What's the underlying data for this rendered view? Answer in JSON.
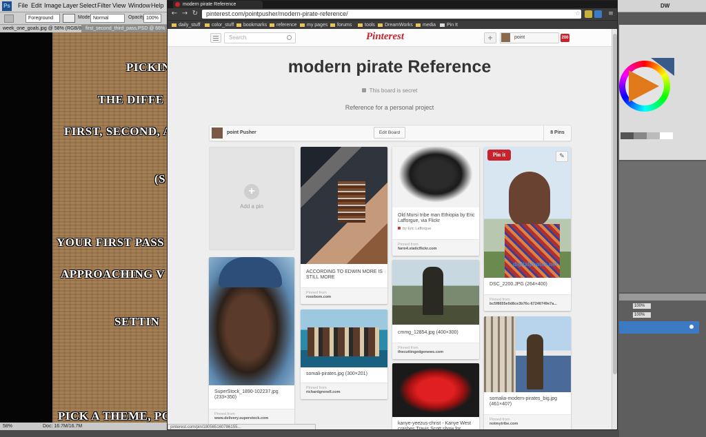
{
  "photoshop": {
    "logo": "Ps",
    "menus": [
      "File",
      "Edit",
      "Image",
      "Layer",
      "Select",
      "Filter",
      "View",
      "Window",
      "Help"
    ],
    "options": {
      "tool_preset": "Foreground",
      "mode_label": "Mode:",
      "mode_value": "Normal",
      "opacity_label": "Opacity:",
      "opacity_value": "100%"
    },
    "doc_tabs": [
      "week_one_goals.jpg @ 58% (RGB/8)",
      "first_second_third_pass.PSD @ 66% (Layer 1, RGB/8)"
    ],
    "canvas_lines": [
      "PICKIN",
      "THE DIFFE",
      "FIRST, SECOND, A",
      "(S",
      "YOUR FIRST PASS",
      "APPROACHING V",
      "SETTIN",
      "PICK A THEME, PO"
    ],
    "status_zoom": "58%",
    "status_doc": "Doc: 16.7M/16.7M",
    "workspace": "DW",
    "panel_fields": [
      "100%",
      "100%"
    ]
  },
  "browser": {
    "tab_title": "modern pirate Reference",
    "url": "pinterest.com/pointpusher/modern-pirate-reference/",
    "bookmarks": [
      "daily_stuff",
      "color_stuff",
      "bookmarks",
      "reference",
      "my pages",
      "forums",
      "tools",
      "DreamWorks",
      "media",
      "Pin It"
    ],
    "status_url": "pinterest.com/pin/180565160786155...",
    "colors": {
      "pinterest_red": "#c8232c",
      "page_bg": "#eeeeee"
    }
  },
  "pinterest": {
    "search_placeholder": "Search",
    "logo": "Pinterest",
    "user": "point",
    "notifications": "200",
    "board": {
      "title": "modern pirate Reference",
      "secret": "This board is secret",
      "description": "Reference for a personal project",
      "owner": "point Pusher",
      "edit_label": "Edit Board",
      "pins_count": "8 Pins"
    },
    "add_pin_label": "Add a pin",
    "pin_it": "Pin it",
    "pins": [
      {
        "caption": "Old Mursi tribe man Ethiopia by Eric Lafforgue, via Flickr",
        "via": "by Eric Lafforgue",
        "src_label": "Pinned from",
        "src": "farm4.staticflickr.com"
      },
      {
        "caption": "DSC_2200.JPG (264×400)",
        "src_label": "Pinned from",
        "src": "bc5f8655e0d8ce3b76c-67246749e7a..."
      },
      {
        "caption": "ACCORDING TO EDWIN MORE IS STILL MORE",
        "src_label": "Pinned from",
        "src": "rosebom.com"
      },
      {
        "caption": "cmmg_12854.jpg (400×300)",
        "src_label": "Pinned from",
        "src": "thecuttingedgenews.com"
      },
      {
        "caption": "SuperStock_1890-102237.jpg (233×350)",
        "src_label": "Pinned from",
        "src": "www.delivery.superstock.com"
      },
      {
        "caption": "somali-pirates.jpg (300×201)",
        "src_label": "Pinned from",
        "src": "richardgrenell.com"
      },
      {
        "caption": "somalia-modern-pirates_big.jpg (461×407)",
        "src_label": "Pinned from",
        "src": "notmytribe.com"
      },
      {
        "caption": "kanye-yeezus-christ - Kanye West crashes Travis Scott show for..."
      }
    ],
    "watermark": "digitalphotos.net"
  }
}
